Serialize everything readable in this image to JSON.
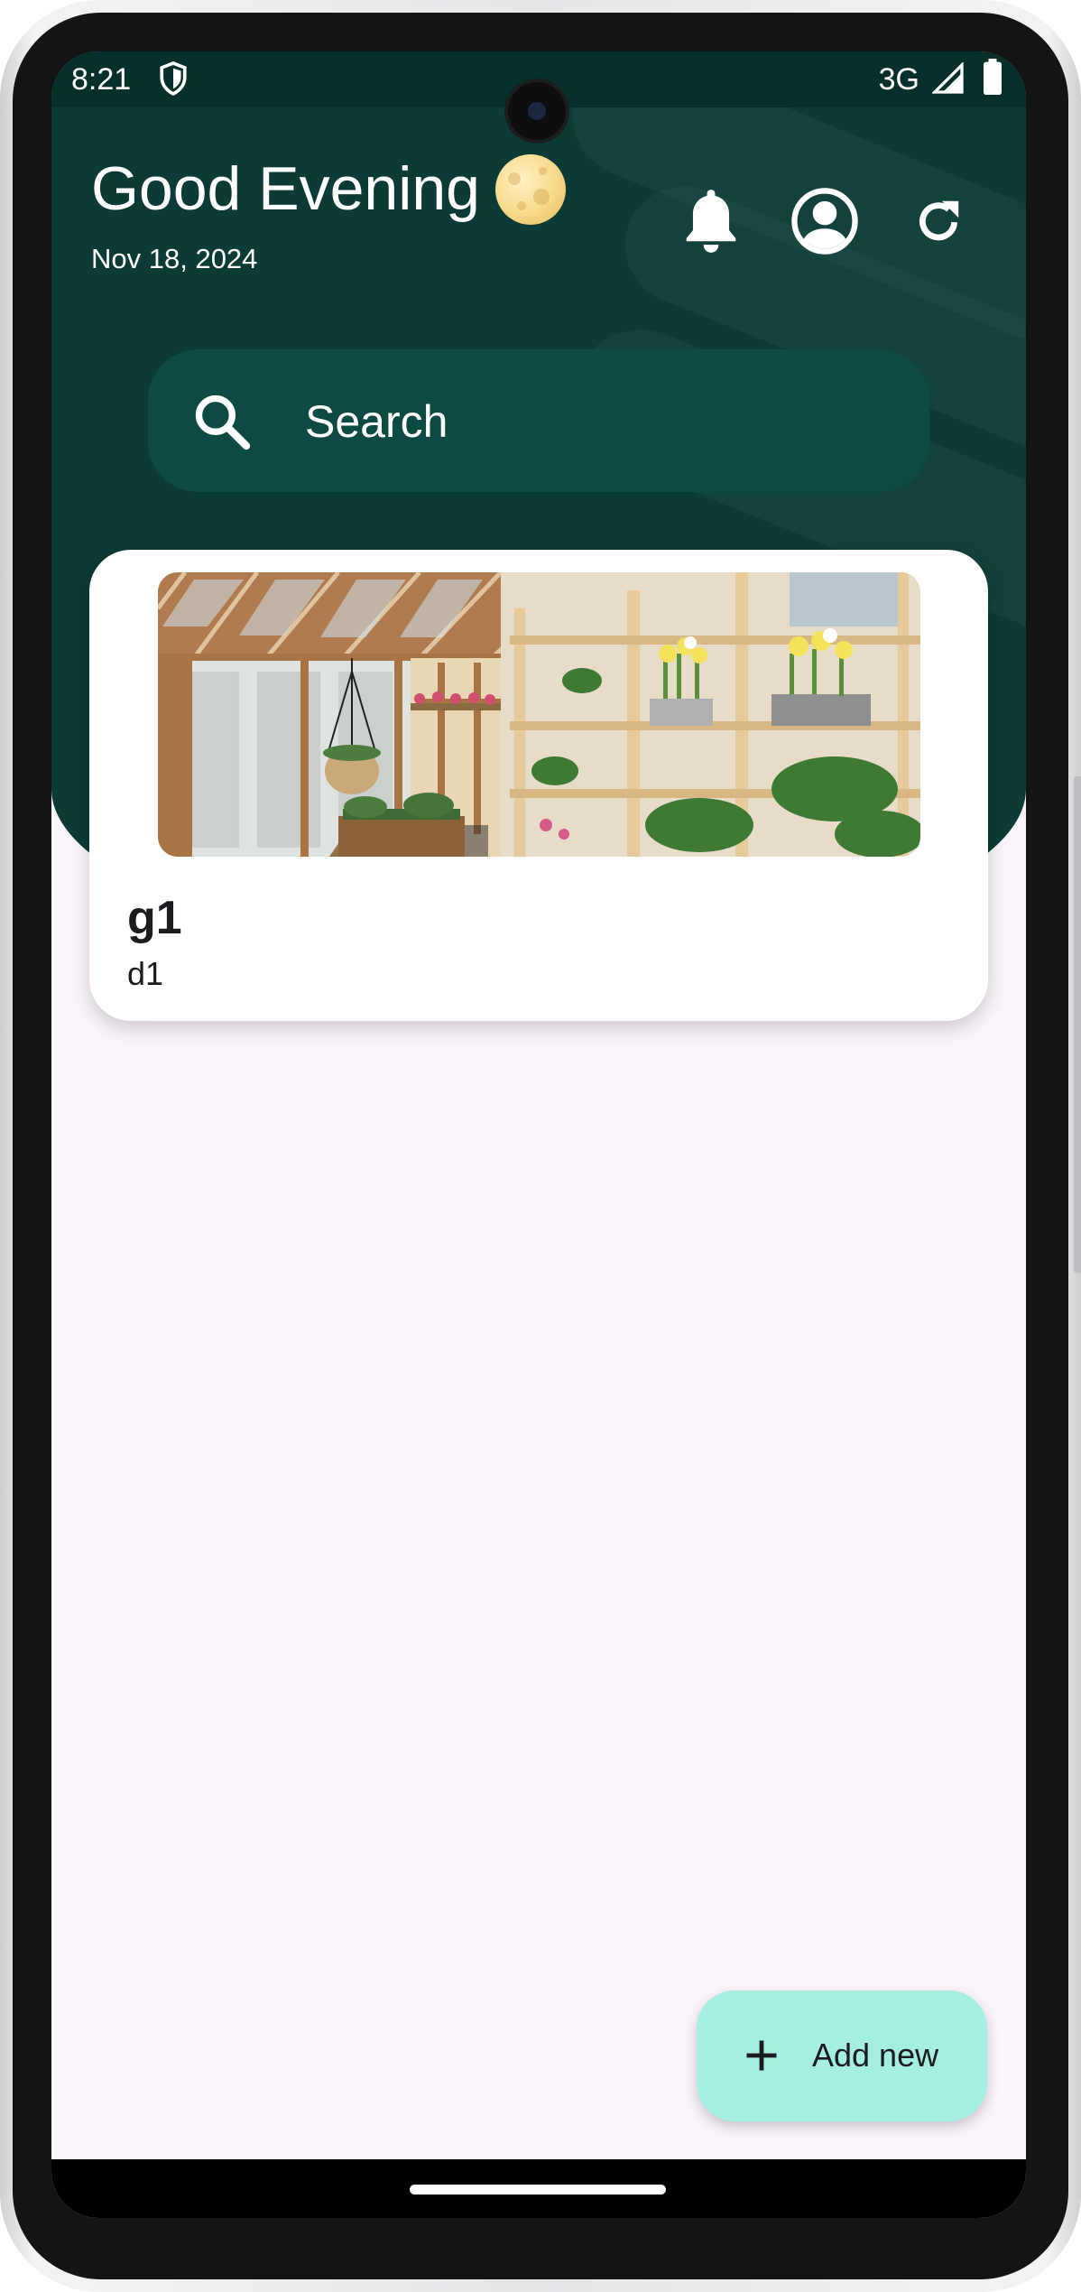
{
  "status_bar": {
    "time": "8:21",
    "network": "3G",
    "icons": [
      "shield-icon",
      "signal-icon",
      "battery-icon"
    ]
  },
  "header": {
    "greeting": "Good Evening",
    "greeting_icon": "moon-icon",
    "date": "Nov 18, 2024",
    "actions": [
      "notifications-bell-icon",
      "profile-icon",
      "refresh-icon"
    ]
  },
  "search": {
    "placeholder": "Search",
    "icon": "search-icon"
  },
  "cards": [
    {
      "title": "g1",
      "description": "d1",
      "image": "greenhouse-photo"
    }
  ],
  "fab": {
    "label": "Add new",
    "icon": "plus-icon"
  },
  "colors": {
    "header_bg": "#0b3b34",
    "search_bg": "#0d4a42",
    "page_bg": "#fbf4fb",
    "fab_bg": "#a5efe1",
    "card_bg": "#ffffff"
  }
}
